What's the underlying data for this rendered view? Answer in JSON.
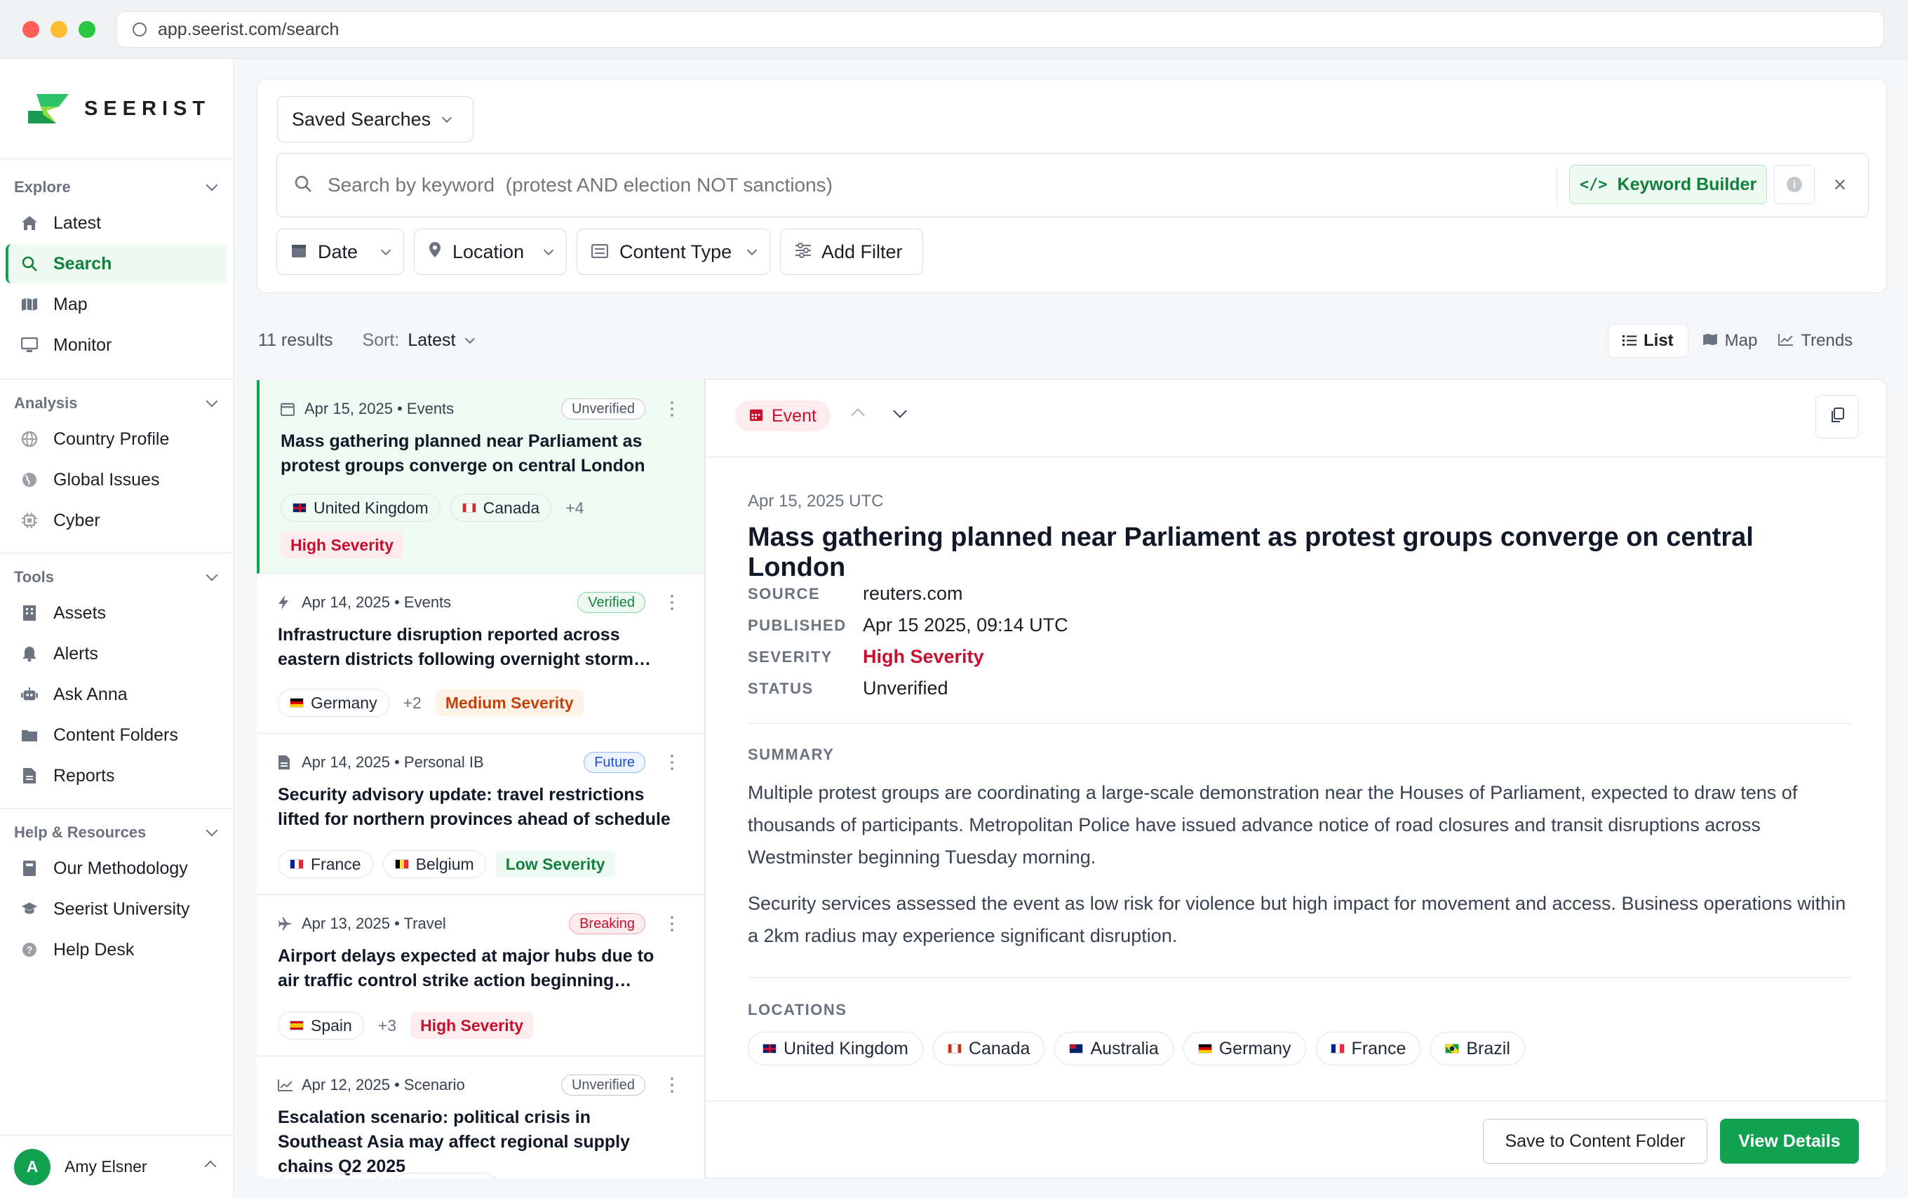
{
  "browser": {
    "url": "app.seerist.com/search"
  },
  "brand": {
    "name": "SEERIST"
  },
  "sidebar": {
    "sections": [
      {
        "title": "Explore",
        "items": [
          "Latest",
          "Search",
          "Map",
          "Monitor"
        ]
      },
      {
        "title": "Analysis",
        "items": [
          "Country Profile",
          "Global Issues",
          "Cyber"
        ]
      },
      {
        "title": "Tools",
        "items": [
          "Assets",
          "Alerts",
          "Ask Anna",
          "Content Folders",
          "Reports"
        ]
      },
      {
        "title": "Help & Resources",
        "items": [
          "Our Methodology",
          "Seerist University",
          "Help Desk"
        ]
      }
    ],
    "active": "Search",
    "user": {
      "initial": "A",
      "name": "Amy Elsner"
    }
  },
  "toolbar": {
    "saved_searches": "Saved Searches",
    "search_placeholder": "Search by keyword  (protest AND election NOT sanctions)",
    "keyword_builder": "Keyword Builder",
    "filters": [
      "Date",
      "Location",
      "Content Type"
    ],
    "add_filter": "Add Filter"
  },
  "results": {
    "count": "11 results",
    "sort_label": "Sort:",
    "sort_value": "Latest",
    "views": [
      "List",
      "Map",
      "Trends"
    ],
    "active_view": "List"
  },
  "cards": [
    {
      "meta": "Apr 15, 2025 • Events",
      "icon": "calendar-icon",
      "badge": "Unverified",
      "title": "Mass gathering planned near Parliament as protest groups converge on central London",
      "chips": [
        "United Kingdom",
        "Canada"
      ],
      "more": "+4",
      "severity": "High Severity"
    },
    {
      "meta": "Apr 14, 2025 • Events",
      "icon": "bolt-icon",
      "badge": "Verified",
      "title": "Infrastructure disruption reported across eastern districts following overnight storm…",
      "chips": [
        "Germany"
      ],
      "more": "+2",
      "severity": "Medium Severity"
    },
    {
      "meta": "Apr 14, 2025 • Personal IB",
      "icon": "document-icon",
      "badge": "Future",
      "title": "Security advisory update: travel restrictions lifted for northern provinces ahead of schedule",
      "chips": [
        "France",
        "Belgium"
      ],
      "more": "",
      "severity": "Low Severity"
    },
    {
      "meta": "Apr 13, 2025 • Travel",
      "icon": "plane-icon",
      "badge": "Breaking",
      "title": "Airport delays expected at major hubs due to air traffic control strike action beginning…",
      "chips": [
        "Spain"
      ],
      "more": "+3",
      "severity": "High Severity"
    },
    {
      "meta": "Apr 12, 2025 • Scenario",
      "icon": "chart-icon",
      "badge": "Unverified",
      "title": "Escalation scenario: political crisis in Southeast Asia may affect regional supply chains Q2 2025",
      "chips": [],
      "more": "",
      "severity": ""
    }
  ],
  "detail": {
    "type": "Event",
    "date": "Apr 15, 2025 UTC",
    "title": "Mass gathering planned near Parliament as protest groups converge on central London",
    "fields": [
      {
        "k": "SOURCE",
        "v": "reuters.com"
      },
      {
        "k": "PUBLISHED",
        "v": "Apr 15 2025, 09:14 UTC"
      },
      {
        "k": "SEVERITY",
        "v": "High Severity"
      },
      {
        "k": "STATUS",
        "v": "Unverified"
      }
    ],
    "summary_label": "SUMMARY",
    "summary": [
      "Multiple protest groups are coordinating a large-scale demonstration near the Houses of Parliament, expected to draw tens of thousands of participants. Metropolitan Police have issued advance notice of road closures and transit disruptions across Westminster beginning Tuesday morning.",
      "Security services assessed the event as low risk for violence but high impact for movement and access. Business operations within a 2km radius may experience significant disruption."
    ],
    "locations_label": "LOCATIONS",
    "locations": [
      "United Kingdom",
      "Canada",
      "Australia",
      "Germany",
      "France",
      "Brazil"
    ],
    "save_btn": "Save to Content Folder",
    "view_btn": "View Details"
  },
  "colors": {
    "brand": "#12a150",
    "high": "#c8102e",
    "medium": "#c2410c",
    "low": "#15803d"
  }
}
